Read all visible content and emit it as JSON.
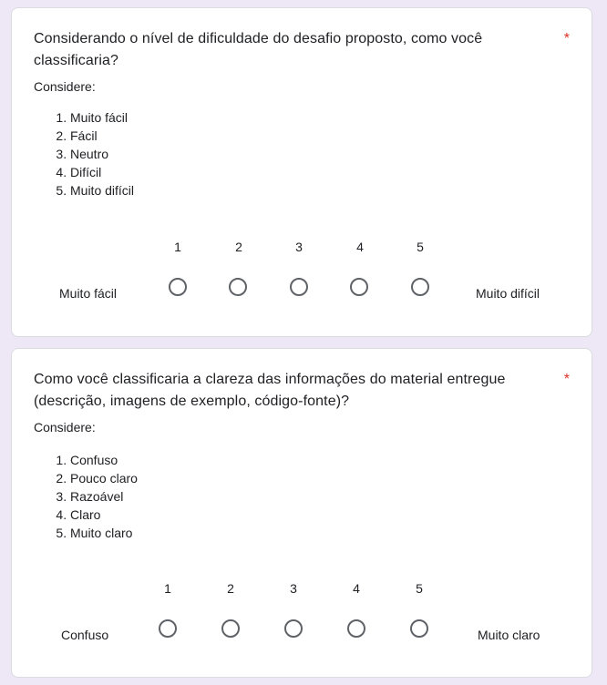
{
  "questions": [
    {
      "title": "Considerando o nível de dificuldade do desafio proposto, como você classificaria?",
      "required_mark": "*",
      "description_label": "Considere:",
      "description_items": [
        "Muito fácil",
        "Fácil",
        "Neutro",
        "Difícil",
        "Muito difícil"
      ],
      "scale_numbers": [
        "1",
        "2",
        "3",
        "4",
        "5"
      ],
      "low_label": "Muito fácil",
      "high_label": "Muito difícil"
    },
    {
      "title": "Como você classificaria a clareza das informações do material entregue (descrição, imagens de exemplo, código-fonte)?",
      "required_mark": "*",
      "description_label": "Considere:",
      "description_items": [
        "Confuso",
        "Pouco claro",
        "Razoável",
        "Claro",
        "Muito claro"
      ],
      "scale_numbers": [
        "1",
        "2",
        "3",
        "4",
        "5"
      ],
      "low_label": "Confuso",
      "high_label": "Muito claro"
    }
  ],
  "colors": {
    "background": "#ede7f6",
    "card": "#ffffff",
    "required": "#d93025",
    "radio_border": "#5f6368"
  }
}
